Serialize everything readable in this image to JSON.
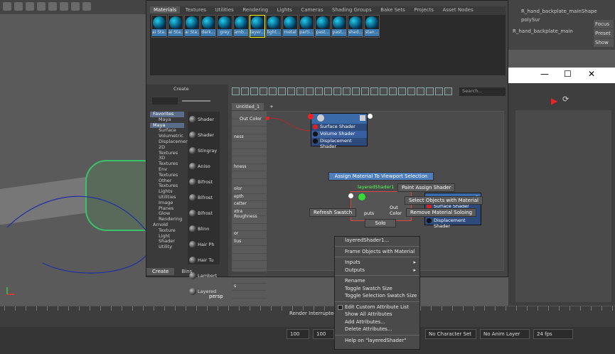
{
  "viewport": {
    "label": "persp"
  },
  "attribute_editor": {
    "tabs": [
      "R_hand_backplate_mainShape",
      "polySur"
    ],
    "node_name": "R_hand_backplate_main",
    "buttons": [
      "Focus",
      "Preset",
      "Show"
    ]
  },
  "hypershade": {
    "material_tabs": [
      "Materials",
      "Textures",
      "Utilities",
      "Rendering",
      "Lights",
      "Cameras",
      "Shading Groups",
      "Bake Sets",
      "Projects",
      "Asset Nodes"
    ],
    "swatches": [
      "ai Sta...",
      "ai Sta...",
      "ai Sta...",
      "dark...",
      "grey",
      "amb...",
      "layer...",
      "light...",
      "metal",
      "parti...",
      "past...",
      "past...",
      "shad...",
      "stan..."
    ],
    "create_panel": {
      "title": "Create",
      "tree": [
        "Favorites",
        "Maya",
        "Maya",
        "Surface",
        "Volumetric",
        "Displacement",
        "2D Textures",
        "3D Textures",
        "Env Textures",
        "Other Textures",
        "Lights",
        "Utilities",
        "Image Planes",
        "Glow",
        "Rendering",
        "Arnold",
        "Texture",
        "Light",
        "Shader",
        "Utility"
      ],
      "shaders": [
        "Shader",
        "Shader",
        "Stingray",
        "Aniso",
        "Bifrost",
        "Bifrost",
        "Bifrost",
        "Blinn",
        "Hair Ph",
        "Hair Tu",
        "Lambert",
        "Layered"
      ],
      "tabs": [
        "Create",
        "Bins"
      ]
    },
    "search_placeholder": "Search...",
    "graph_tabs": [
      "Untitled_1",
      "+"
    ],
    "attr_rows": [
      "",
      "",
      "",
      "ness",
      "",
      "",
      "",
      "hness",
      "",
      "",
      "olor",
      "epth",
      "catter",
      "xtra Roughness",
      "",
      "",
      "or",
      "lius",
      "",
      "",
      "",
      "",
      "",
      "s",
      ""
    ],
    "sg_node": {
      "ports": [
        "Surface Shader",
        "Volume Shader",
        "Displacement Shader"
      ]
    },
    "layered_node": {
      "name": "layeredShader1",
      "out": "Out Color",
      "inputs": "puts"
    },
    "out_color": "Out Color",
    "sg2_node": {
      "ports": [
        "Surface Shader",
        "Displacement Shader"
      ],
      "suffix": "G"
    },
    "marking_menu": {
      "assign": "Assign Material To Viewport Selection",
      "paint": "Paint Assign Shader",
      "select": "Select Objects with Material",
      "refresh": "Refresh Swatch",
      "remove": "Remove Material Soloing",
      "solo": "Solo"
    }
  },
  "context_menu": {
    "items": [
      {
        "label": "layeredShader1...",
        "sep_after": true
      },
      {
        "label": "Frame Objects with Material",
        "sep_after": true
      },
      {
        "label": "Inputs",
        "arrow": true
      },
      {
        "label": "Outputs",
        "arrow": true,
        "sep_after": true
      },
      {
        "label": "Rename"
      },
      {
        "label": "Toggle Swatch Size"
      },
      {
        "label": "Toggle Selection Swatch Size",
        "sep_after": true
      },
      {
        "label": "Edit Custom Attribute List",
        "check": true
      },
      {
        "label": "Show All Attributes"
      },
      {
        "label": "Add Attributes..."
      },
      {
        "label": "Delete Attributes...",
        "sep_after": true
      },
      {
        "label": "Help on \"layeredShader\""
      }
    ]
  },
  "bottom": {
    "render_status": "Render Interrupted",
    "time_field": "100",
    "time_field2": "100",
    "character_set": "No Character Set",
    "anim_layer": "No Anim Layer",
    "fps": "24 fps"
  }
}
